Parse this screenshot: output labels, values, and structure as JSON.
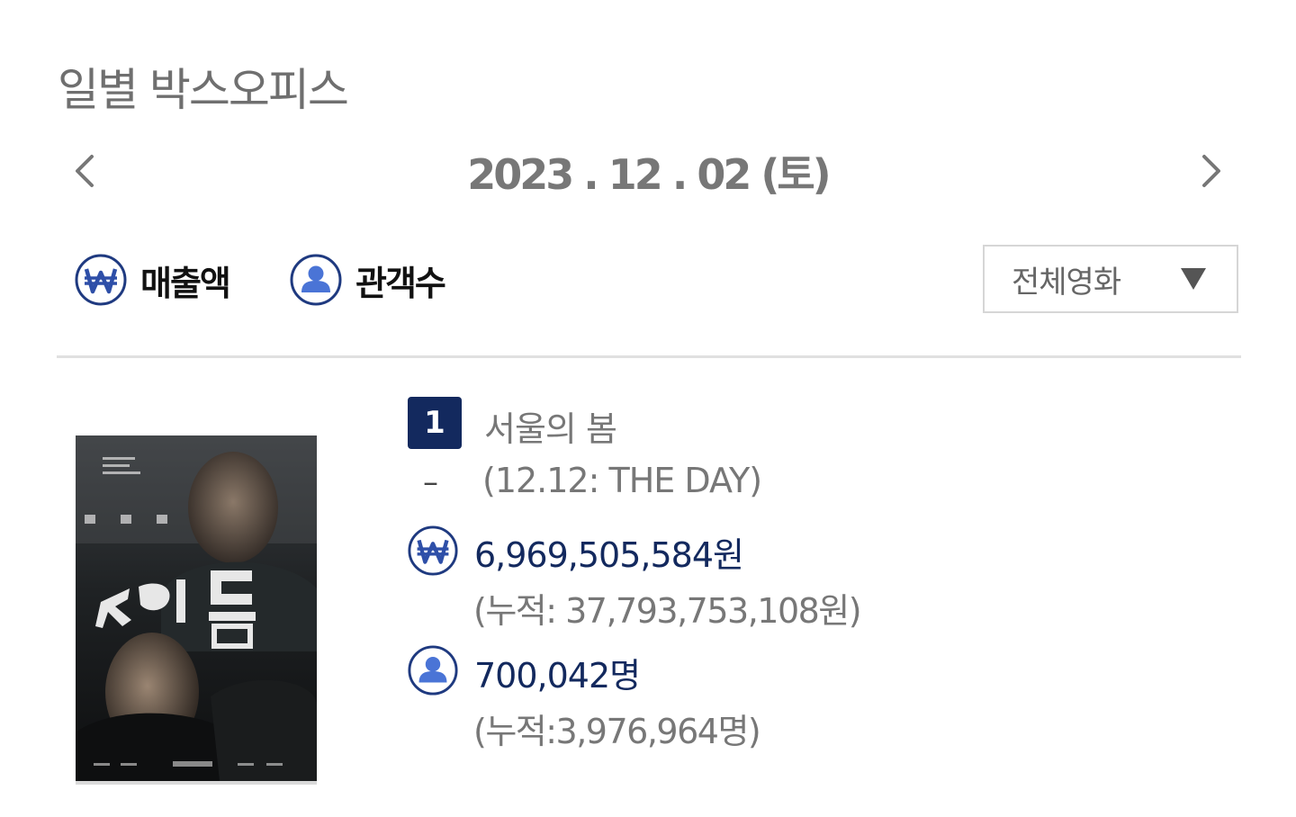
{
  "header": {
    "title": "일별 박스오피스"
  },
  "date_nav": {
    "date": "2023 . 12 . 02 (토)",
    "prev_icon": "chevron-left-icon",
    "next_icon": "chevron-right-icon"
  },
  "metrics": {
    "revenue_label": "매출액",
    "revenue_icon": "won-icon",
    "audience_label": "관객수",
    "audience_icon": "person-icon"
  },
  "filter": {
    "selected": "전체영화",
    "icon": "triangle-down-icon"
  },
  "colors": {
    "accent_navy": "#13295e",
    "won_blue": "#2e4fa8",
    "person_blue": "#4a74d6",
    "muted_text": "#777777"
  },
  "movies": [
    {
      "rank": "1",
      "rank_change": "–",
      "title": "서울의 봄",
      "subtitle": "(12.12: THE DAY)",
      "daily_revenue": "6,969,505,584원",
      "cumulative_revenue": "(누적: 37,793,753,108원)",
      "daily_audience": "700,042명",
      "cumulative_audience": "(누적:3,976,964명)"
    }
  ]
}
